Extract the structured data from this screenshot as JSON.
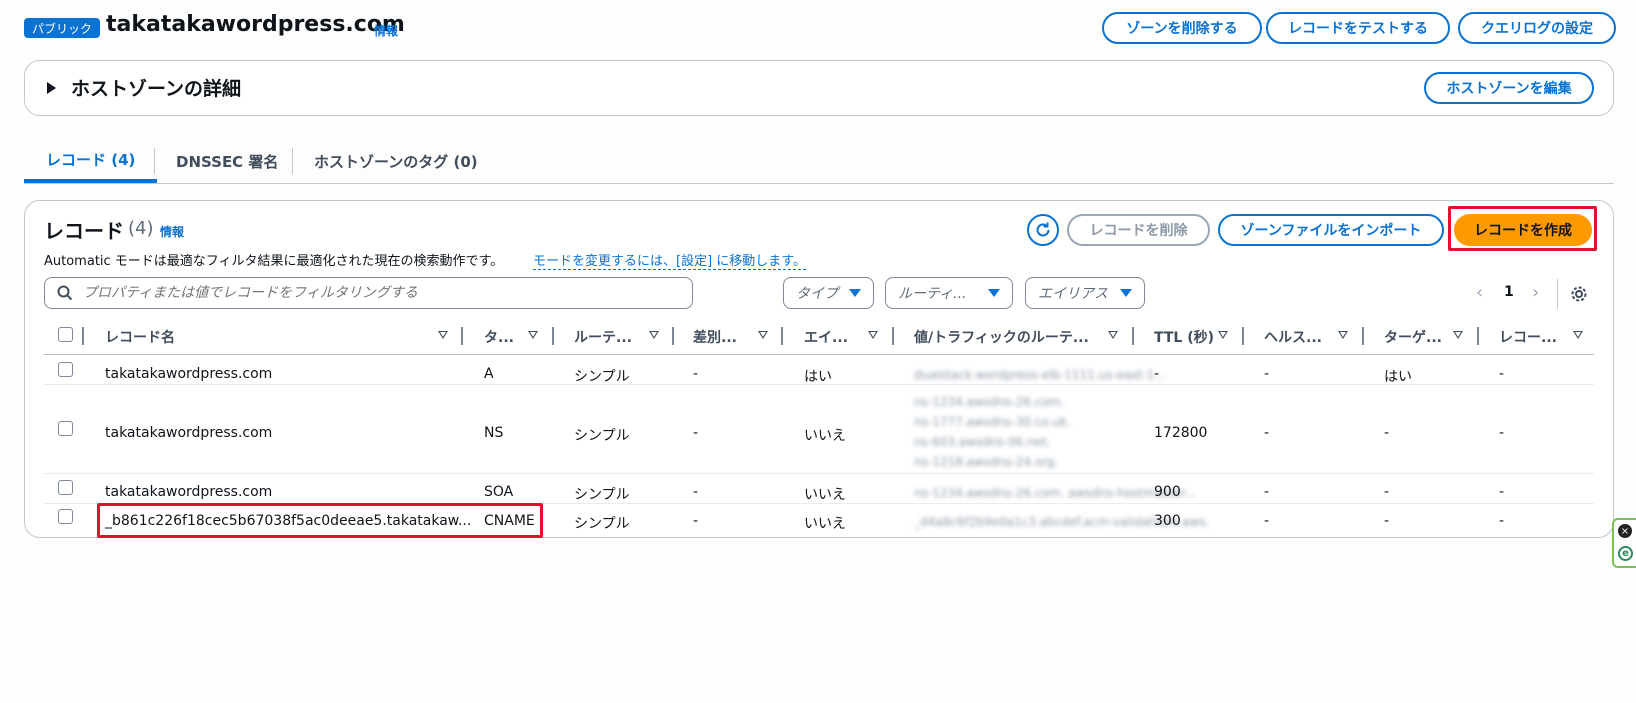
{
  "header": {
    "badge": "パブリック",
    "zone_name": "takatakawordpress.com",
    "info": "情報",
    "buttons": {
      "delete_zone": "ゾーンを削除する",
      "test_record": "レコードをテストする",
      "query_log": "クエリログの設定"
    }
  },
  "details_panel": {
    "title": "ホストゾーンの詳細",
    "edit_button": "ホストゾーンを編集"
  },
  "tabs": [
    {
      "label": "レコード (4)",
      "active": true
    },
    {
      "label": "DNSSEC 署名",
      "active": false
    },
    {
      "label": "ホストゾーンのタグ (0)",
      "active": false
    }
  ],
  "records_panel": {
    "title": "レコード",
    "count": "(4)",
    "info": "情報",
    "mode_text": "Automatic モードは最適なフィルタ結果に最適化された現在の検索動作です。",
    "mode_link": "モードを変更するには、[設定] に移動します。",
    "buttons": {
      "delete_record": "レコードを削除",
      "import_zone": "ゾーンファイルをインポート",
      "create_record": "レコードを作成"
    },
    "search_placeholder": "プロパティまたは値でレコードをフィルタリングする",
    "filters": [
      "タイプ",
      "ルーティ...",
      "エイリアス"
    ],
    "page": "1"
  },
  "table": {
    "columns": [
      "レコード名",
      "タ...",
      "ルーテ...",
      "差別...",
      "エイ...",
      "値/トラフィックのルーテ...",
      "TTL (秒)",
      "ヘルス...",
      "ターゲ...",
      "レコー..."
    ],
    "rows": [
      {
        "name": "takatakawordpress.com",
        "type": "A",
        "routing": "シンプル",
        "diff": "-",
        "alias": "はい",
        "value": [
          "dualstack.wordpress-elb-1111.us-east-1..."
        ],
        "ttl": "-",
        "health": "-",
        "target": "はい",
        "record_id": "-"
      },
      {
        "name": "takatakawordpress.com",
        "type": "NS",
        "routing": "シンプル",
        "diff": "-",
        "alias": "いいえ",
        "value": [
          "ns-1234.awsdns-26.com.",
          "ns-1777.awsdns-30.co.uk.",
          "ns-603.awsdns-06.net.",
          "ns-1218.awsdns-24.org."
        ],
        "ttl": "172800",
        "health": "-",
        "target": "-",
        "record_id": "-"
      },
      {
        "name": "takatakawordpress.com",
        "type": "SOA",
        "routing": "シンプル",
        "diff": "-",
        "alias": "いいえ",
        "value": [
          "ns-1234.awsdns-26.com. awsdns-hostmaster..."
        ],
        "ttl": "900",
        "health": "-",
        "target": "-",
        "record_id": "-"
      },
      {
        "name": "_b861c226f18cec5b67038f5ac0deeae5.takatakaw...",
        "type": "CNAME",
        "routing": "シンプル",
        "diff": "-",
        "alias": "いいえ",
        "value": [
          "_d4a8c6f2b9e0a1c3.abcdef.acm-validations.aws."
        ],
        "ttl": "300",
        "health": "-",
        "target": "-",
        "record_id": "-"
      }
    ]
  },
  "colors": {
    "accent": "#0972d3",
    "primary_button": "#ff9900",
    "highlight": "#e0102f"
  },
  "icons": [
    "refresh-icon",
    "search-icon",
    "settings-icon",
    "chevron-left-icon",
    "chevron-right-icon",
    "caret-right-icon"
  ]
}
